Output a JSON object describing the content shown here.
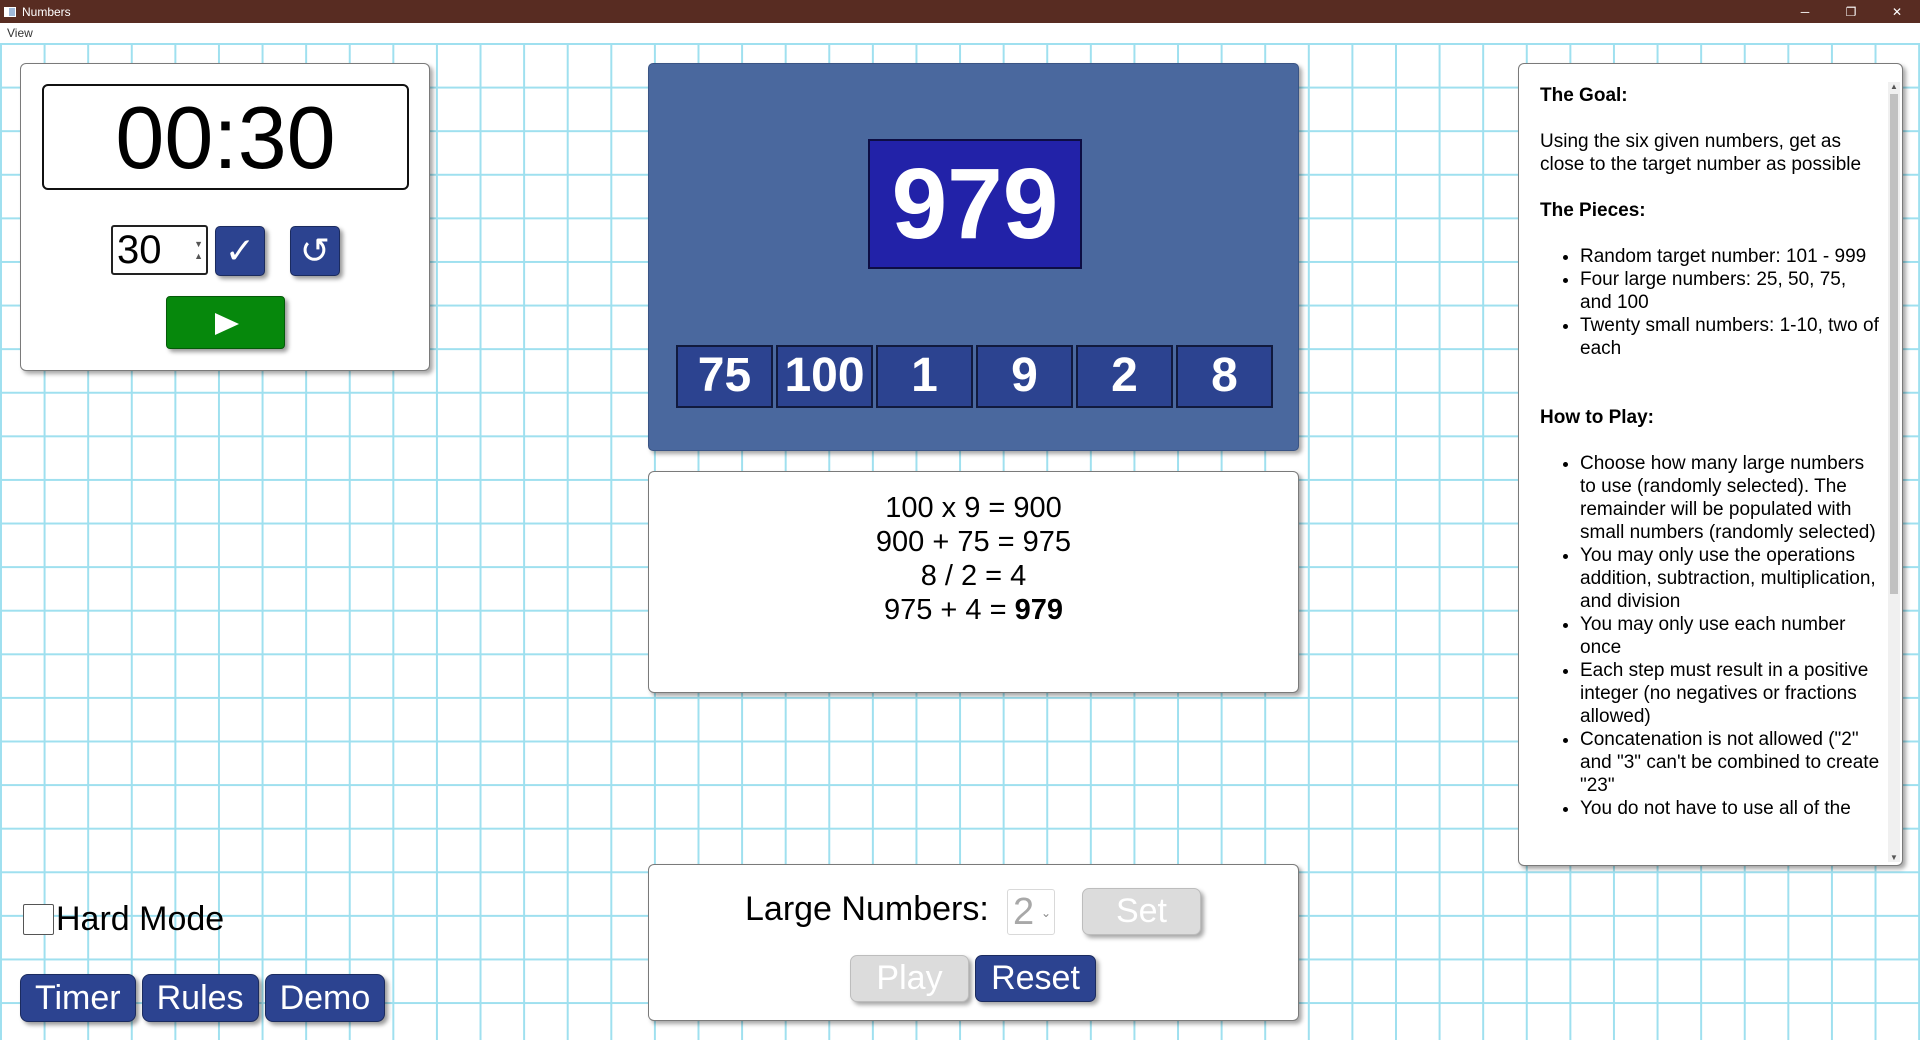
{
  "window": {
    "title": "Numbers",
    "controls": {
      "minimize": "─",
      "restore": "❐",
      "close": "✕"
    }
  },
  "menubar": {
    "view_label": "View"
  },
  "timer": {
    "display": "00:30",
    "seconds_value": "30",
    "confirm_icon": "✓",
    "reset_icon": "↺"
  },
  "board": {
    "target": "979",
    "tiles": [
      "75",
      "100",
      "1",
      "9",
      "2",
      "8"
    ]
  },
  "solution": {
    "lines": [
      "100 x 9 = 900",
      "900 + 75 = 975",
      "8 / 2 = 4"
    ],
    "final_prefix": "975 + 4 = ",
    "final_result": "979"
  },
  "rules": {
    "goal_heading": "The Goal:",
    "goal_text": "Using the six given numbers, get as close to the target number as possible",
    "pieces_heading": "The Pieces:",
    "pieces": [
      "Random target number: 101 - 999",
      "Four large numbers: 25, 50, 75, and 100",
      "Twenty small numbers: 1-10, two of each"
    ],
    "howto_heading": "How to Play:",
    "howto": [
      "Choose how many large numbers to use (randomly selected). The remainder will be populated with small numbers (randomly selected)",
      "You may only use the operations addition, subtraction, multiplication, and division",
      "You may only use each number once",
      "Each step must result in a positive integer (no negatives or fractions allowed)",
      "Concatenation is not allowed (\"2\" and \"3\" can't be combined to create \"23\"",
      "You do not have to use all of the"
    ]
  },
  "controls": {
    "large_numbers_label": "Large Numbers:",
    "large_numbers_value": "2",
    "set_label": "Set",
    "play_label": "Play",
    "reset_label": "Reset"
  },
  "hard_mode": {
    "label": "Hard Mode",
    "checked": false
  },
  "nav": {
    "timer_label": "Timer",
    "rules_label": "Rules",
    "demo_label": "Demo"
  },
  "colors": {
    "titlebar": "#582c22",
    "grid_line": "#9fe0ef",
    "board_bg": "#4a689e",
    "target_bg": "#2222a8",
    "button_blue": "#2c4390",
    "play_green": "#06880c",
    "disabled_gray": "#dcdcdc"
  }
}
